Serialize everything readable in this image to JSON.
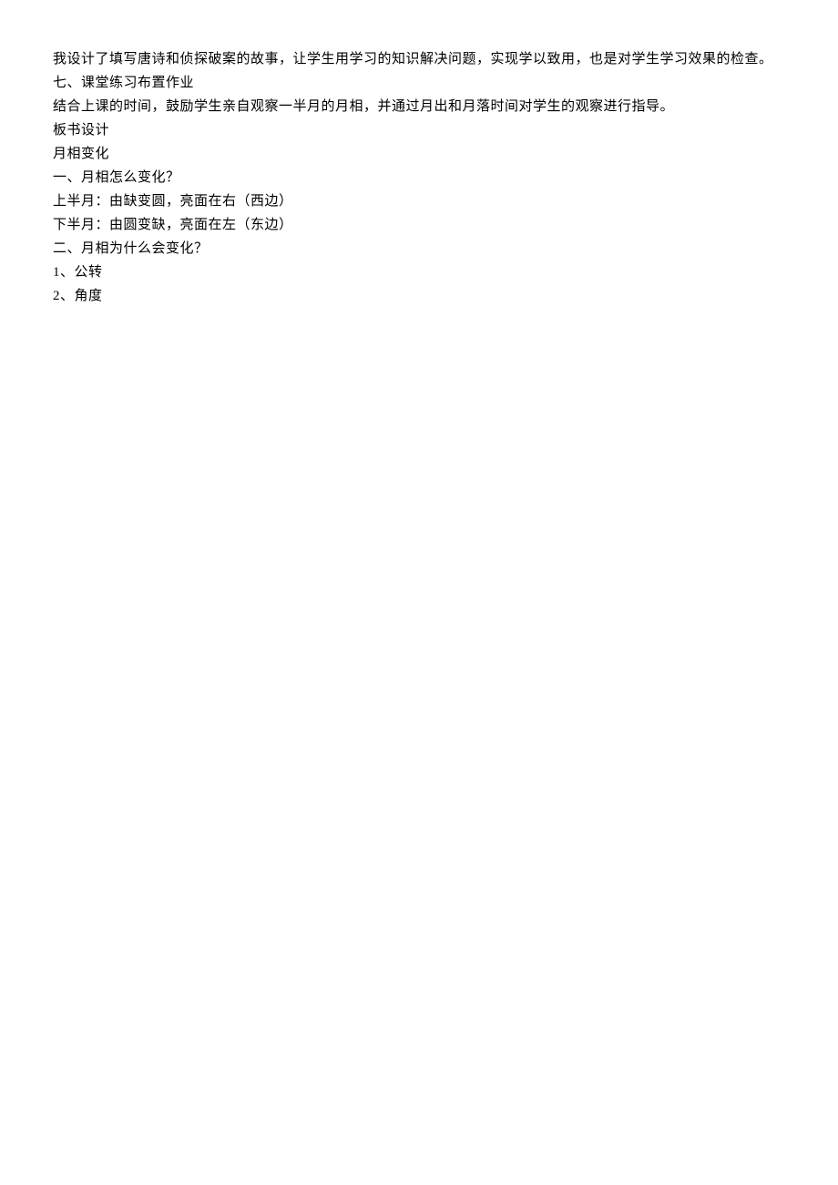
{
  "lines": [
    "我设计了填写唐诗和侦探破案的故事，让学生用学习的知识解决问题，实现学以致用，也是对学生学习效果的检查。",
    "七、课堂练习布置作业",
    "结合上课的时间，鼓励学生亲自观察一半月的月相，并通过月出和月落时间对学生的观察进行指导。",
    "板书设计",
    "月相变化",
    "一、月相怎么变化？",
    "上半月：由缺变圆，亮面在右（西边）",
    "下半月：由圆变缺，亮面在左（东边）",
    "二、月相为什么会变化？",
    "1、公转",
    "2、角度"
  ]
}
